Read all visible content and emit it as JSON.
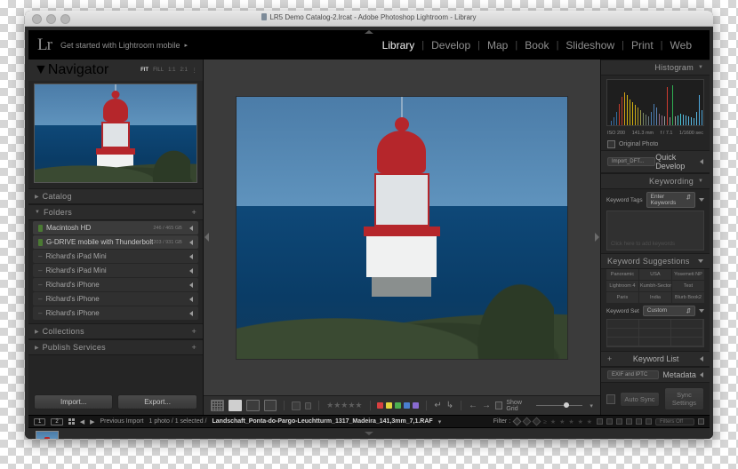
{
  "window": {
    "title": "LR5 Demo Catalog-2.lrcat - Adobe Photoshop Lightroom - Library",
    "doc_icon": "document-icon"
  },
  "identity": {
    "logo": "Lr",
    "tagline": "Get started with Lightroom mobile",
    "arrow": "▸"
  },
  "modules": [
    {
      "label": "Library",
      "active": true
    },
    {
      "label": "Develop",
      "active": false
    },
    {
      "label": "Map",
      "active": false
    },
    {
      "label": "Book",
      "active": false
    },
    {
      "label": "Slideshow",
      "active": false
    },
    {
      "label": "Print",
      "active": false
    },
    {
      "label": "Web",
      "active": false
    }
  ],
  "left": {
    "navigator": {
      "title": "Navigator",
      "zoom_levels": [
        "FIT",
        "FILL",
        "1:1",
        "2:1"
      ],
      "active_zoom": "FIT"
    },
    "catalog": {
      "title": "Catalog"
    },
    "folders": {
      "title": "Folders",
      "add_label": "+",
      "items": [
        {
          "name": "Macintosh HD",
          "size": "246 / 465 GB",
          "type": "volume",
          "selected": true
        },
        {
          "name": "G-DRIVE mobile with Thunderbolt",
          "size": "203 / 931 GB",
          "type": "volume",
          "selected": true
        },
        {
          "name": "Richard's iPad Mini",
          "size": "",
          "type": "offline",
          "selected": false
        },
        {
          "name": "Richard's iPad Mini",
          "size": "",
          "type": "offline",
          "selected": false
        },
        {
          "name": "Richard's iPhone",
          "size": "",
          "type": "offline",
          "selected": false
        },
        {
          "name": "Richard's iPhone",
          "size": "",
          "type": "offline",
          "selected": false
        },
        {
          "name": "Richard's iPhone",
          "size": "",
          "type": "offline",
          "selected": false
        }
      ]
    },
    "collections": {
      "title": "Collections",
      "add_label": "+"
    },
    "publish": {
      "title": "Publish Services",
      "add_label": "+"
    },
    "import_button": "Import...",
    "export_button": "Export..."
  },
  "right": {
    "histogram": {
      "title": "Histogram",
      "iso": "ISO 200",
      "focal": "141.3 mm",
      "aperture": "f / 7.1",
      "shutter": "1/1600 sec"
    },
    "original_photo": "Original Photo",
    "quick_develop": {
      "title": "Quick Develop",
      "preset": "Import_DFT..."
    },
    "keywording": {
      "title": "Keywording",
      "tags_label": "Keyword Tags",
      "tags_value": "Enter Keywords",
      "hint": "Click here to add keywords"
    },
    "keyword_suggestions": {
      "title": "Keyword Suggestions",
      "items": [
        "Panoramic",
        "USA",
        "Yosemeti NP",
        "Lightroom 4",
        "Kumbh-Sector 12",
        "Test",
        "Paris",
        "India",
        "Blurb Book2"
      ]
    },
    "keyword_set": {
      "label": "Keyword Set",
      "value": "Custom"
    },
    "keyword_list": {
      "title": "Keyword List",
      "add_label": "+"
    },
    "metadata": {
      "title": "Metadata",
      "preset": "EXIF and IPTC"
    },
    "sync": {
      "auto_sync": "Auto Sync",
      "sync_settings": "Sync Settings"
    }
  },
  "toolbar": {
    "view_modes": [
      "grid-view-icon",
      "loupe-view-icon",
      "compare-view-icon",
      "survey-view-icon"
    ],
    "flag_icons": [
      "flag-pick-icon",
      "flag-reject-icon"
    ],
    "stars": "★★★★★",
    "color_labels": [
      "#d94040",
      "#e3d43c",
      "#4caf50",
      "#4a7fd0",
      "#8a6bd1"
    ],
    "rotate_left": "rotate-left-icon",
    "rotate_right": "rotate-right-icon",
    "prev": "←",
    "next": "→",
    "show_grid_label": "Show Grid",
    "chevron": "▾"
  },
  "status": {
    "page_buttons": [
      "1",
      "2"
    ],
    "grid_icon": "grid-icon",
    "prev_arrow": "◀",
    "next_arrow": "▶",
    "source": "Previous Import",
    "count": "1 photo / 1 selected /",
    "filename": "Landschaft_Ponta-do-Pargo-Leuchtturm_1317_Madeira_141,3mm_7,1.RAF",
    "filename_caret": "▾",
    "filter_label": "Filter :",
    "filter_stars": "≥ ★ ★ ★ ★ ★",
    "filters_off": "Filters Off"
  },
  "colors": {
    "module_active": "#f2f2f2",
    "panel_bg": "#252525",
    "canvas_bg": "#3a3a3a",
    "sea": "#0e4878",
    "sky": "#5f93bd",
    "lighthouse_red": "#b5262b"
  }
}
